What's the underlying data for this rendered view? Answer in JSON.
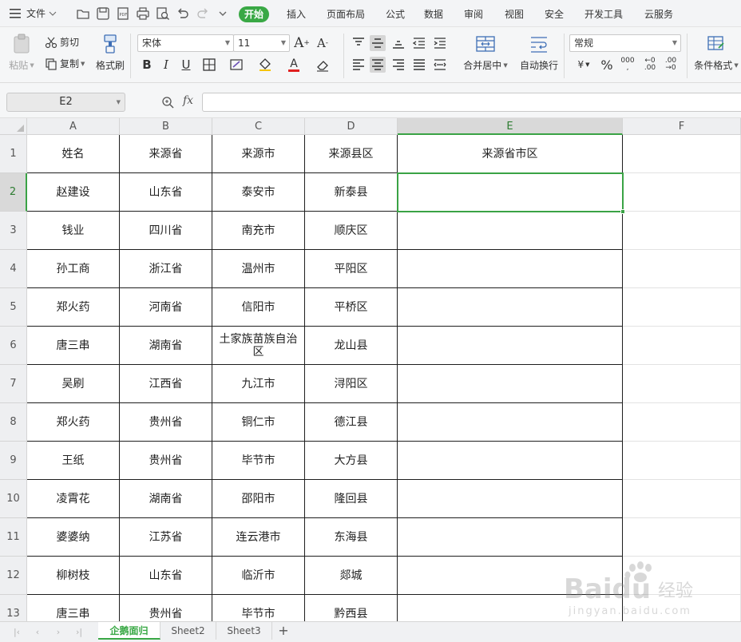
{
  "topbar": {
    "file_label": "文件",
    "menus": [
      "开始",
      "插入",
      "页面布局",
      "公式",
      "数据",
      "审阅",
      "视图",
      "安全",
      "开发工具",
      "云服务"
    ],
    "active_menu": "开始"
  },
  "ribbon": {
    "paste_label": "粘贴",
    "cut_label": "剪切",
    "copy_label": "复制",
    "format_painter_label": "格式刷",
    "font_name": "宋体",
    "font_size": "11",
    "merge_center_label": "合并居中",
    "wrap_text_label": "自动换行",
    "number_format": "常规",
    "conditional_format_label": "条件格式"
  },
  "formula_bar": {
    "name_box": "E2",
    "fx_label": "fx",
    "value": ""
  },
  "sheet": {
    "columns": [
      "A",
      "B",
      "C",
      "D",
      "E",
      "F"
    ],
    "rows": [
      "1",
      "2",
      "3",
      "4",
      "5",
      "6",
      "7",
      "8",
      "9",
      "10",
      "11",
      "12",
      "13"
    ],
    "data": [
      [
        "姓名",
        "来源省",
        "来源市",
        "来源县区",
        "来源省市区"
      ],
      [
        "赵建设",
        "山东省",
        "泰安市",
        "新泰县",
        ""
      ],
      [
        "钱业",
        "四川省",
        "南充市",
        "顺庆区",
        ""
      ],
      [
        "孙工商",
        "浙江省",
        "温州市",
        "平阳区",
        ""
      ],
      [
        "郑火药",
        "河南省",
        "信阳市",
        "平桥区",
        ""
      ],
      [
        "唐三串",
        "湖南省",
        "土家族苗族自治区",
        "龙山县",
        ""
      ],
      [
        "吴刷",
        "江西省",
        "九江市",
        "浔阳区",
        ""
      ],
      [
        "郑火药",
        "贵州省",
        "铜仁市",
        "德江县",
        ""
      ],
      [
        "王纸",
        "贵州省",
        "毕节市",
        "大方县",
        ""
      ],
      [
        "凌霄花",
        "湖南省",
        "邵阳市",
        "隆回县",
        ""
      ],
      [
        "婆婆纳",
        "江苏省",
        "连云港市",
        "东海县",
        ""
      ],
      [
        "柳树枝",
        "山东省",
        "临沂市",
        "郯城",
        ""
      ],
      [
        "唐三串",
        "贵州省",
        "毕节市",
        "黔西县",
        ""
      ]
    ],
    "selected_cell": "E2"
  },
  "sheet_tabs": {
    "tabs": [
      "企鹅面归",
      "Sheet2",
      "Sheet3"
    ],
    "active": "企鹅面归",
    "add_label": "+"
  },
  "watermark": {
    "brand": "Baidu",
    "cn": "经验",
    "url": "jingyan.baidu.com"
  },
  "colors": {
    "accent": "#39a845",
    "ribbon_bg": "#f5f6f7",
    "grid_border": "#1e1e1e",
    "header_bg": "#eeeff1"
  }
}
